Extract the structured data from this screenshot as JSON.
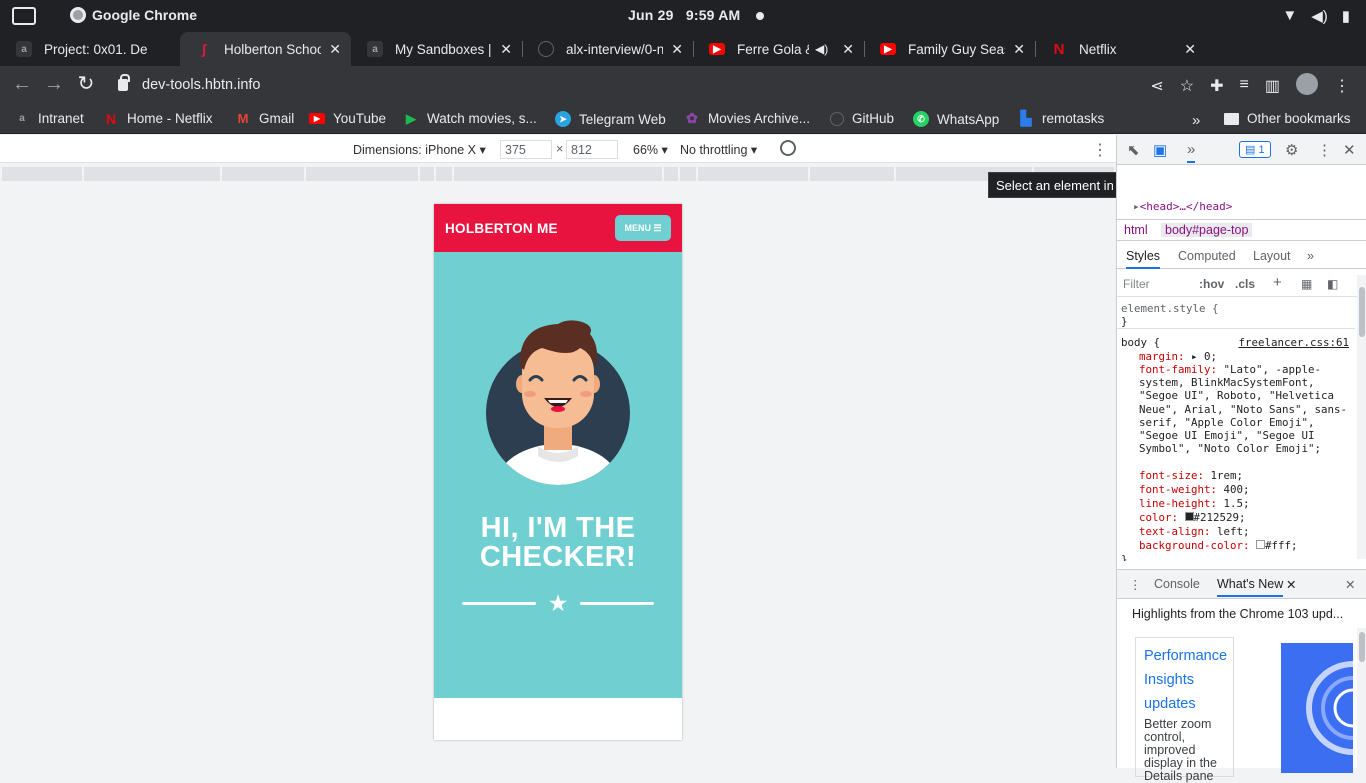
{
  "os": {
    "app_name": "Google Chrome",
    "date": "Jun 29",
    "time": "9:59 AM"
  },
  "tabs": [
    {
      "title": "Project: 0x01. De",
      "favicon": "alx-icon",
      "color": "#35363a"
    },
    {
      "title": "Holberton Schoo",
      "favicon": "holberton-icon",
      "color": "#e8133f"
    },
    {
      "title": "My Sandboxes | A",
      "favicon": "alx-icon",
      "color": "#35363a"
    },
    {
      "title": "alx-interview/0-n",
      "favicon": "github-icon",
      "color": "#35363a"
    },
    {
      "title": "Ferre Gola & F",
      "favicon": "youtube-icon",
      "color": "#ff0000"
    },
    {
      "title": "Family Guy Seaso",
      "favicon": "youtube-icon",
      "color": "#ff0000"
    },
    {
      "title": "Netflix",
      "favicon": "netflix-icon",
      "color": "#e50914"
    }
  ],
  "address": {
    "url": "dev-tools.hbtn.info"
  },
  "bookmarks": [
    {
      "label": "Intranet",
      "icon": "alx-icon",
      "color": "#35363a"
    },
    {
      "label": "Home - Netflix",
      "icon": "netflix-icon",
      "color": "#e50914"
    },
    {
      "label": "Gmail",
      "icon": "gmail-icon",
      "color": "#ea4335"
    },
    {
      "label": "YouTube",
      "icon": "youtube-icon",
      "color": "#ff0000"
    },
    {
      "label": "Watch movies, s...",
      "icon": "play-icon",
      "color": "#1db954"
    },
    {
      "label": "Telegram Web",
      "icon": "telegram-icon",
      "color": "#2aa3df"
    },
    {
      "label": "Movies Archive...",
      "icon": "movies-icon",
      "color": "#8e44ad"
    },
    {
      "label": "GitHub",
      "icon": "github-icon",
      "color": "#35363a"
    },
    {
      "label": "WhatsApp",
      "icon": "whatsapp-icon",
      "color": "#25d366"
    },
    {
      "label": "remotasks",
      "icon": "remotasks-icon",
      "color": "#2b7de9"
    }
  ],
  "bookmarks_other": "Other bookmarks",
  "device_toolbar": {
    "dimensions": "Dimensions: iPhone X",
    "width": "375",
    "height": "812",
    "zoom": "66%",
    "throttling": "No throttling"
  },
  "site": {
    "brand": "HOLBERTON ME",
    "menu": "MENU",
    "hero": "HI, I'M THE CHECKER!"
  },
  "devtools": {
    "tooltip": "Select an element in the page to inspect it - Ctrl+Shift+C",
    "issues_count": "1",
    "head_line": "<head>…</head>",
    "crumb_html": "html",
    "crumb_body": "body#page-top",
    "tabs": [
      "Styles",
      "Computed",
      "Layout"
    ],
    "filter": "Filter",
    "hov": ":hov",
    "cls": ".cls",
    "element_style": "element.style {",
    "brace_close": "}",
    "body_rule": "body {",
    "source": "freelancer.css:61",
    "props": [
      {
        "p": "margin",
        "v": "▸ 0;"
      },
      {
        "p": "font-family",
        "v": "\"Lato\", -apple-system, BlinkMacSystemFont, \"Segoe UI\", Roboto, \"Helvetica Neue\", Arial, \"Noto Sans\", sans-serif, \"Apple Color Emoji\", \"Segoe UI Emoji\", \"Segoe UI Symbol\", \"Noto Color Emoji\";"
      },
      {
        "p": "font-size",
        "v": "1rem;"
      },
      {
        "p": "font-weight",
        "v": "400;"
      },
      {
        "p": "line-height",
        "v": "1.5;"
      },
      {
        "p": "color",
        "v": "#212529;"
      },
      {
        "p": "text-align",
        "v": "left;"
      },
      {
        "p": "background-color",
        "v": "#fff;"
      }
    ],
    "drawer_tabs": [
      "Console",
      "What's New"
    ],
    "whats_new_heading": "Highlights from the Chrome 103 upd...",
    "card_title": "Performance Insights updates",
    "card_desc": "Better zoom control, improved display in the Details pane"
  }
}
